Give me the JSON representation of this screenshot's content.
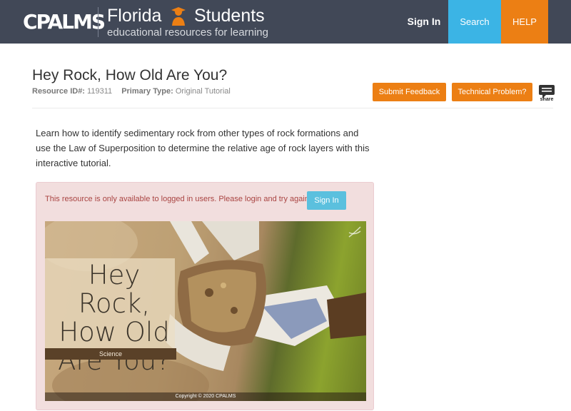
{
  "header": {
    "logo": "CPALMS",
    "brand_title": "Florida",
    "brand_students": "Students",
    "brand_sub": "educational resources for learning",
    "nav": {
      "signin": "Sign In",
      "search": "Search",
      "help": "HELP"
    },
    "colors": {
      "bar": "#414857",
      "search": "#3bb4e5",
      "help": "#ec7f14"
    }
  },
  "resource": {
    "title": "Hey Rock, How Old Are You?",
    "id_label": "Resource ID#:",
    "id_value": "119311",
    "type_label": "Primary Type:",
    "type_value": "Original Tutorial",
    "feedback_label": "Submit Feedback",
    "tech_label": "Technical Problem?",
    "share_label": "share",
    "description": "Learn how to identify sedimentary rock from other types of rock formations and use the Law of Superposition to determine the relative age of rock layers with this interactive tutorial."
  },
  "alert": {
    "message": "This resource is only available to logged in users. Please login and try again.",
    "signin_label": "Sign In"
  },
  "tutorial_image": {
    "title": "Hey Rock, How Old Are You?",
    "title_lines": [
      "Hey Rock,",
      "How Old",
      "Are You?"
    ],
    "subject": "Science",
    "copyright": "Copyright © 2020 CPALMS"
  }
}
